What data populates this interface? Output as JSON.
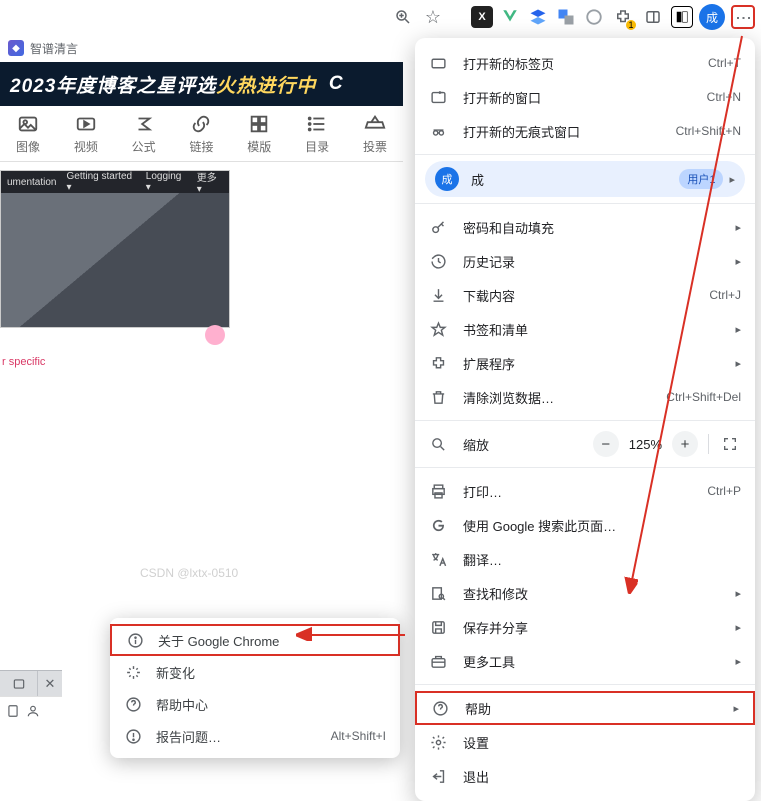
{
  "toolbar": {
    "bookmark_name": "智谱清言",
    "puzzle_badge": "1",
    "avatar_char": "成"
  },
  "banner": {
    "text_pre": "2023年度博客之星评选",
    "text_hot": "火热进行中"
  },
  "editor_tools": [
    "图像",
    "视频",
    "公式",
    "链接",
    "模版",
    "目录",
    "投票"
  ],
  "content_nav": [
    "umentation",
    "Getting started ▾",
    "Logging ▾",
    "更多 ▾"
  ],
  "red_text": "r specific",
  "watermark1": "CSDN @lxtx-0510",
  "watermark2": "CSDN @lxtx-0510",
  "chrome_menu": {
    "new_tab": {
      "label": "打开新的标签页",
      "shortcut": "Ctrl+T"
    },
    "new_window": {
      "label": "打开新的窗口",
      "shortcut": "Ctrl+N"
    },
    "new_incognito": {
      "label": "打开新的无痕式窗口",
      "shortcut": "Ctrl+Shift+N"
    },
    "profile_name": "成",
    "profile_tag": "用户1",
    "passwords": {
      "label": "密码和自动填充"
    },
    "history": {
      "label": "历史记录"
    },
    "downloads": {
      "label": "下载内容",
      "shortcut": "Ctrl+J"
    },
    "bookmarks": {
      "label": "书签和清单"
    },
    "extensions": {
      "label": "扩展程序"
    },
    "clear_data": {
      "label": "清除浏览数据…",
      "shortcut": "Ctrl+Shift+Del"
    },
    "zoom": {
      "label": "缩放",
      "value": "125%"
    },
    "print": {
      "label": "打印…",
      "shortcut": "Ctrl+P"
    },
    "google_search": {
      "label": "使用 Google 搜索此页面…"
    },
    "translate": {
      "label": "翻译…"
    },
    "find_edit": {
      "label": "查找和修改"
    },
    "save_share": {
      "label": "保存并分享"
    },
    "more_tools": {
      "label": "更多工具"
    },
    "help": {
      "label": "帮助"
    },
    "settings": {
      "label": "设置"
    },
    "exit": {
      "label": "退出"
    }
  },
  "help_menu": {
    "about": {
      "label": "关于 Google Chrome"
    },
    "whats_new": {
      "label": "新变化"
    },
    "help_center": {
      "label": "帮助中心"
    },
    "report": {
      "label": "报告问题…",
      "shortcut": "Alt+Shift+I"
    }
  }
}
